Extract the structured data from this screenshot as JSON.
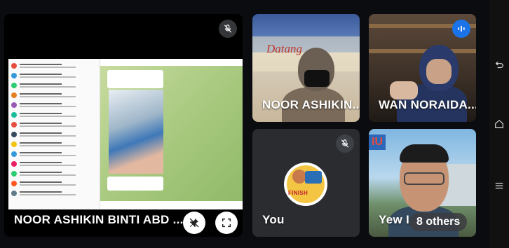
{
  "main_tile": {
    "name": "NOOR ASHIKIN BINTI ABD ..."
  },
  "tiles": {
    "noor": {
      "name": "NOOR ASHIKIN..."
    },
    "wan": {
      "name": "WAN NORAIDA..."
    },
    "you": {
      "name": "You"
    },
    "yew": {
      "name": "Yew I",
      "others": "8 others"
    }
  },
  "banner": {
    "text": "Datang"
  },
  "icons": {
    "mic_off": "mic-off-icon",
    "speaking": "audio-wave-icon",
    "pin": "pin-off-icon",
    "fullscreen": "fullscreen-icon",
    "back": "back-icon",
    "home": "home-icon",
    "menu": "menu-icon"
  },
  "colors": {
    "speaking": "#1a73e8",
    "tile_bg": "#1c1d21"
  }
}
